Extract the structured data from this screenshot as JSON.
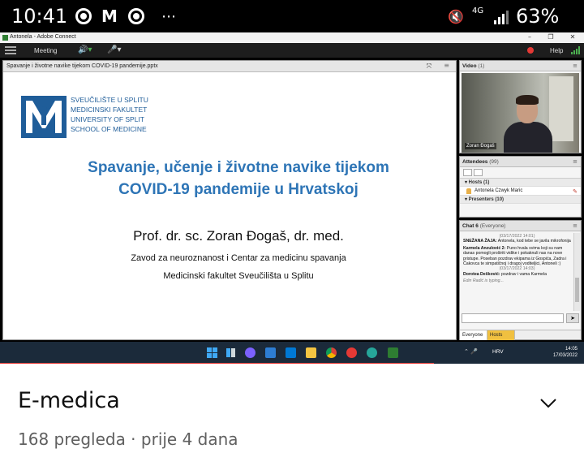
{
  "status_bar": {
    "time": "10:41",
    "more": "⋯",
    "network": "4G",
    "battery": "63%"
  },
  "window": {
    "title": "Antonela - Adobe Connect",
    "controls": [
      "–",
      "❐",
      "✕"
    ]
  },
  "menubar": {
    "meeting_label": "Meeting",
    "help_label": "Help"
  },
  "share_pod": {
    "title": "Spavanje i životne navike tijekom COVID-19 pandemije.pptx"
  },
  "slide": {
    "logo_lines": [
      "SVEUČILIŠTE U SPLITU",
      "MEDICINSKI FAKULTET",
      "UNIVERSITY OF SPLIT",
      "SCHOOL OF MEDICINE"
    ],
    "title_line1": "Spavanje, učenje i životne navike tijekom",
    "title_line2": "COVID-19 pandemije u Hrvatskoj",
    "author": "Prof. dr. sc. Zoran Đogaš, dr. med.",
    "dept1": "Zavod za neuroznanost i Centar za medicinu spavanja",
    "dept2": "Medicinski fakultet Sveučilišta u Splitu"
  },
  "video_pod": {
    "title": "Video",
    "count": "(1)",
    "participant": "Zoran Đogaš"
  },
  "attendees_pod": {
    "title": "Attendees",
    "count": "(99)",
    "hosts_label": "▾ Hosts (1)",
    "host_name": "Antonela Czwyk Maric",
    "presenters_label": "▾ Presenters (10)"
  },
  "chat_pod": {
    "title": "Chat 6",
    "audience": "(Everyone)",
    "messages": [
      {
        "sep": "(03/17/2022 14:01)"
      },
      {
        "author": "SNEŽANA ŽAJA:",
        "text": "Antonela, kod tebe se javila mikrofonija"
      },
      {
        "author": "Karmela Anzulović 2:",
        "text": "Puno hvala svima koji su nam danas pomogli proširiti vidike i pokaknuli nas na nove pristupe. Poseban pozdrav ekipama iz Gospića, Zadra i Čakovca te simpatičnoj i dragoj voditeljici, Antoneli :)"
      },
      {
        "sep": "(03/17/2022 14:03)"
      },
      {
        "author": "Dorotea Dešković:",
        "text": "pozdrav i vama Karmela"
      }
    ],
    "typing": "Edin Radić is typing...",
    "tab_everyone": "Everyone",
    "tab_hosts": "Hosts"
  },
  "taskbar": {
    "tray": "⌃  🎤",
    "lang": "HRV",
    "time": "14:05",
    "date": "17/03/2022"
  },
  "youtube": {
    "title": "E-medica",
    "meta": "168 pregleda · prije 4 dana"
  }
}
